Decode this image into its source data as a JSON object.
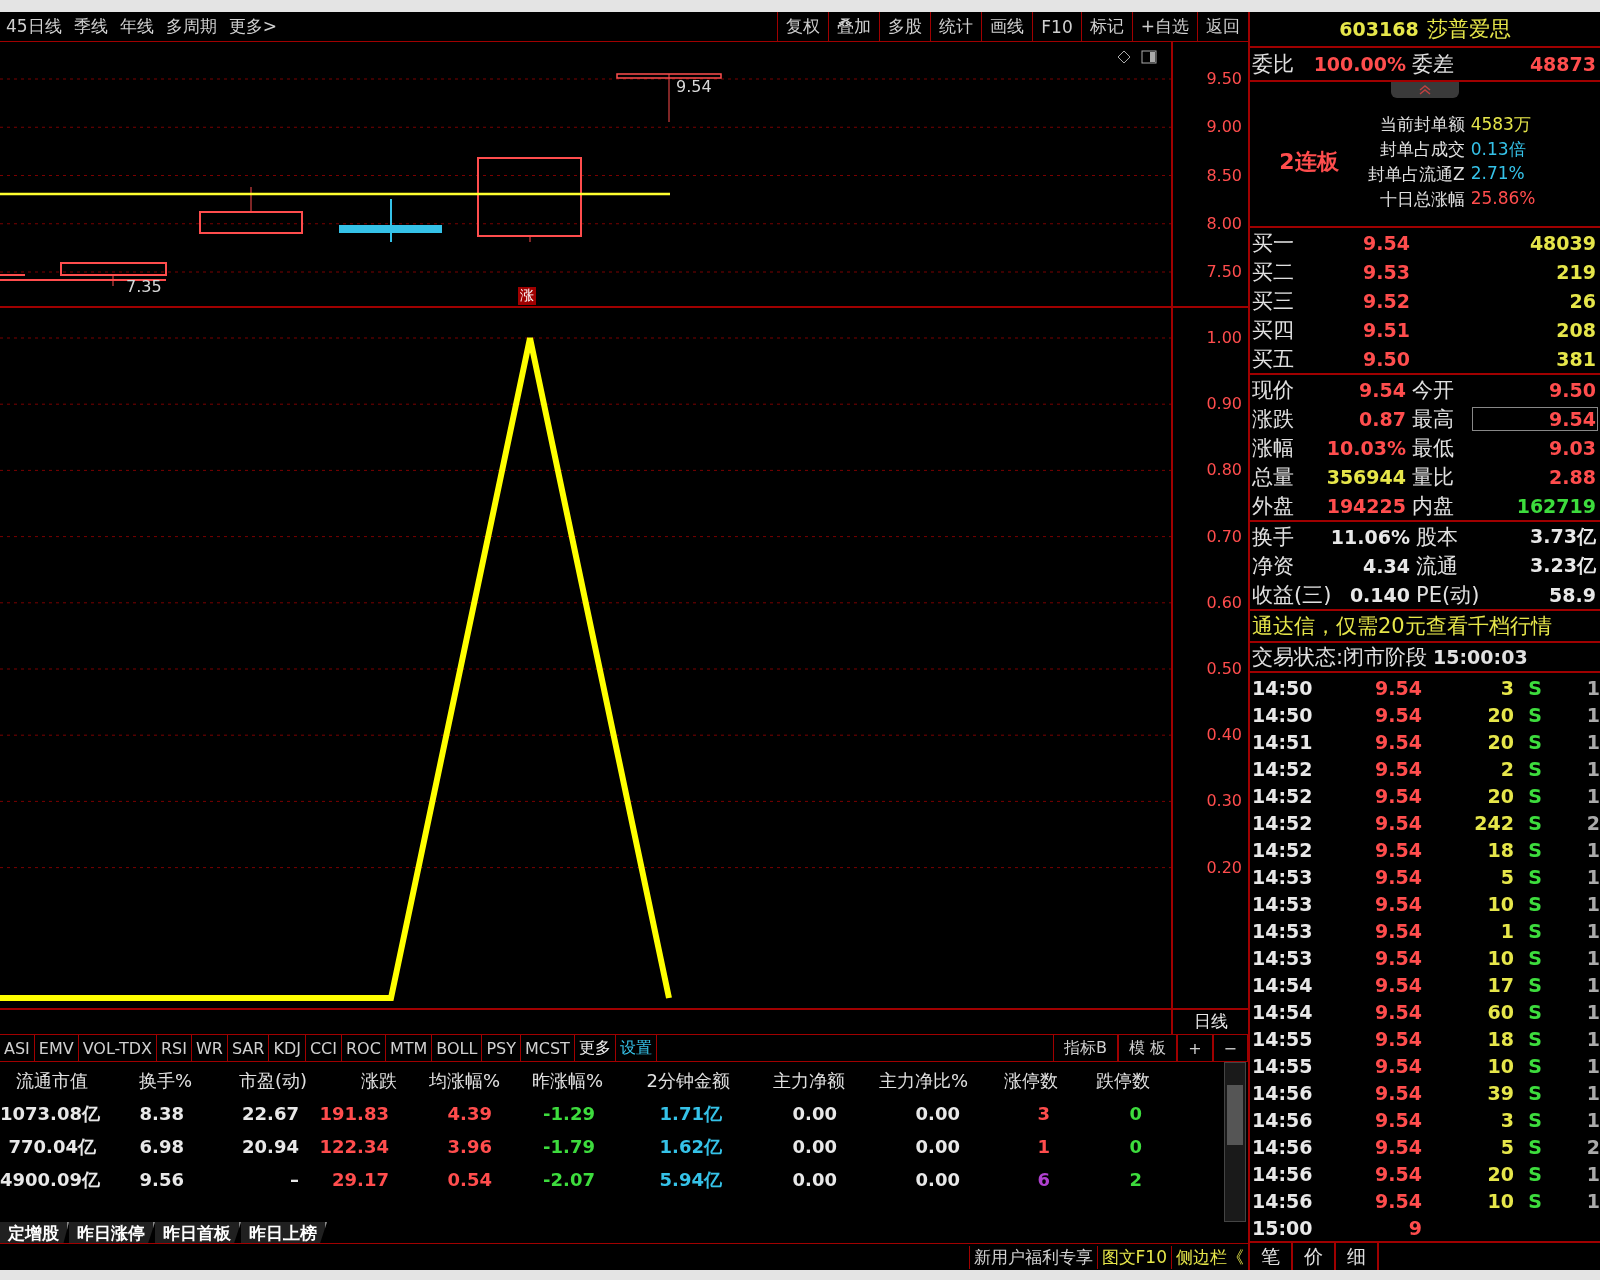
{
  "toolbar": {
    "periods": [
      {
        "label": "45日线",
        "selected": false
      },
      {
        "label": "季线",
        "selected": false
      },
      {
        "label": "年线",
        "selected": false
      },
      {
        "label": "多周期",
        "selected": false
      },
      {
        "label": "更多>",
        "selected": false
      }
    ],
    "actions": [
      "复权",
      "叠加",
      "多股",
      "统计",
      "画线",
      "F10",
      "标记",
      "+自选",
      "返回"
    ]
  },
  "price_chart": {
    "ticks": [
      "9.50",
      "9.00",
      "8.50",
      "8.00",
      "7.50"
    ],
    "high_mark": "9.54",
    "low_mark": "7.35",
    "limit_up_tag": "涨"
  },
  "indicator_chart": {
    "ticks": [
      "1.00",
      "0.90",
      "0.80",
      "0.70",
      "0.60",
      "0.50",
      "0.40",
      "0.30",
      "0.20"
    ],
    "period_label": "日线"
  },
  "indicator_tabs": [
    {
      "label": "ASI",
      "kind": "indicator"
    },
    {
      "label": "EMV",
      "kind": "indicator"
    },
    {
      "label": "VOL-TDX",
      "kind": "indicator"
    },
    {
      "label": "RSI",
      "kind": "indicator"
    },
    {
      "label": "WR",
      "kind": "indicator"
    },
    {
      "label": "SAR",
      "kind": "indicator"
    },
    {
      "label": "KDJ",
      "kind": "indicator"
    },
    {
      "label": "CCI",
      "kind": "indicator"
    },
    {
      "label": "ROC",
      "kind": "indicator"
    },
    {
      "label": "MTM",
      "kind": "indicator"
    },
    {
      "label": "BOLL",
      "kind": "indicator"
    },
    {
      "label": "PSY",
      "kind": "indicator"
    },
    {
      "label": "MCST",
      "kind": "indicator"
    },
    {
      "label": "更多",
      "kind": "more"
    },
    {
      "label": "设置",
      "kind": "settings"
    }
  ],
  "indicator_actions": [
    "指标B",
    "模 板",
    "+",
    "−"
  ],
  "table": {
    "columns": [
      "流通市值",
      "换手%",
      "市盈(动)",
      "涨跌",
      "均涨幅%",
      "昨涨幅%",
      "2分钟金额",
      "主力净额",
      "主力净比%",
      "涨停数",
      "跌停数"
    ],
    "rows": [
      [
        {
          "text": "1073.08亿",
          "color": "#e8e8e8"
        },
        {
          "text": "8.38",
          "color": "#e8e8e8"
        },
        {
          "text": "22.67",
          "color": "#e8e8e8"
        },
        {
          "text": "191.83",
          "color": "#ff4d4d"
        },
        {
          "text": "4.39",
          "color": "#ff4d4d"
        },
        {
          "text": "-1.29",
          "color": "#3ddc3d"
        },
        {
          "text": "1.71亿",
          "color": "#35c2e8"
        },
        {
          "text": "0.00",
          "color": "#e8e8e8"
        },
        {
          "text": "0.00",
          "color": "#e8e8e8"
        },
        {
          "text": "3",
          "color": "#ff4d4d"
        },
        {
          "text": "0",
          "color": "#3ddc3d"
        }
      ],
      [
        {
          "text": "770.04亿",
          "color": "#e8e8e8"
        },
        {
          "text": "6.98",
          "color": "#e8e8e8"
        },
        {
          "text": "20.94",
          "color": "#e8e8e8"
        },
        {
          "text": "122.34",
          "color": "#ff4d4d"
        },
        {
          "text": "3.96",
          "color": "#ff4d4d"
        },
        {
          "text": "-1.79",
          "color": "#3ddc3d"
        },
        {
          "text": "1.62亿",
          "color": "#35c2e8"
        },
        {
          "text": "0.00",
          "color": "#e8e8e8"
        },
        {
          "text": "0.00",
          "color": "#e8e8e8"
        },
        {
          "text": "1",
          "color": "#ff4d4d"
        },
        {
          "text": "0",
          "color": "#3ddc3d"
        }
      ],
      [
        {
          "text": "4900.09亿",
          "color": "#e8e8e8"
        },
        {
          "text": "9.56",
          "color": "#e8e8e8"
        },
        {
          "text": "–",
          "color": "#e8e8e8"
        },
        {
          "text": "29.17",
          "color": "#ff4d4d"
        },
        {
          "text": "0.54",
          "color": "#ff4d4d"
        },
        {
          "text": "-2.07",
          "color": "#3ddc3d"
        },
        {
          "text": "5.94亿",
          "color": "#35c2e8"
        },
        {
          "text": "0.00",
          "color": "#e8e8e8"
        },
        {
          "text": "0.00",
          "color": "#e8e8e8"
        },
        {
          "text": "6",
          "color": "#b040d0"
        },
        {
          "text": "2",
          "color": "#3ddc3d"
        }
      ]
    ]
  },
  "sheet_tabs": [
    "定增股",
    "昨日涨停",
    "昨日首板",
    "昨日上榜"
  ],
  "status_bar": [
    {
      "text": "新用户福利专享",
      "kind": "plain"
    },
    {
      "text": "图文F10",
      "kind": "highlight"
    },
    {
      "text": "侧边栏《",
      "kind": "highlight"
    }
  ],
  "quote": {
    "code": "603168",
    "name": "莎普爱思"
  },
  "order_ratio": [
    {
      "label": "委比",
      "value": "100.00%"
    },
    {
      "label": "委差",
      "value": "48873"
    }
  ],
  "limit_board": {
    "title": "2连板",
    "stats": [
      {
        "label": "当前封单额",
        "value": "4583万",
        "color": "#e6e64a"
      },
      {
        "label": "封单占成交",
        "value": "0.13倍",
        "color": "#35c2e8"
      },
      {
        "label": "封单占流通Z",
        "value": "2.71%",
        "color": "#35c2e8"
      },
      {
        "label": "十日总涨幅",
        "value": "25.86%",
        "color": "#ff4d4d"
      }
    ]
  },
  "bids": [
    {
      "label": "买一",
      "price": "9.54",
      "volume": "48039"
    },
    {
      "label": "买二",
      "price": "9.53",
      "volume": "219"
    },
    {
      "label": "买三",
      "price": "9.52",
      "volume": "26"
    },
    {
      "label": "买四",
      "price": "9.51",
      "volume": "208"
    },
    {
      "label": "买五",
      "price": "9.50",
      "volume": "381"
    }
  ],
  "stats": [
    [
      {
        "label": "现价",
        "value": "9.54",
        "color": "#ff4d4d",
        "highlighted": false
      },
      {
        "label": "今开",
        "value": "9.50",
        "color": "#ff4d4d",
        "highlighted": false
      }
    ],
    [
      {
        "label": "涨跌",
        "value": "0.87",
        "color": "#ff4d4d",
        "highlighted": false
      },
      {
        "label": "最高",
        "value": "9.54",
        "color": "#ff4d4d",
        "highlighted": true
      }
    ],
    [
      {
        "label": "涨幅",
        "value": "10.03%",
        "color": "#ff4d4d",
        "highlighted": false
      },
      {
        "label": "最低",
        "value": "9.03",
        "color": "#ff4d4d",
        "highlighted": false
      }
    ],
    [
      {
        "label": "总量",
        "value": "356944",
        "color": "#e6e64a",
        "highlighted": false
      },
      {
        "label": "量比",
        "value": "2.88",
        "color": "#ff4d4d",
        "highlighted": false
      }
    ],
    [
      {
        "label": "外盘",
        "value": "194225",
        "color": "#ff4d4d",
        "highlighted": false
      },
      {
        "label": "内盘",
        "value": "162719",
        "color": "#3ddc3d",
        "highlighted": false
      }
    ]
  ],
  "fundamentals": [
    [
      {
        "label": "换手",
        "value": "11.06%"
      },
      {
        "label": "股本",
        "value": "3.73亿"
      }
    ],
    [
      {
        "label": "净资",
        "value": "4.34"
      },
      {
        "label": "流通",
        "value": "3.23亿"
      }
    ],
    [
      {
        "label": "收益(三)",
        "value": "0.140"
      },
      {
        "label": "PE(动)",
        "value": "58.9"
      }
    ]
  ],
  "notice": "通达信，仅需20元查看千档行情",
  "trade_status": {
    "label": "交易状态:闭市阶段",
    "time": "15:00:03"
  },
  "ticks": [
    {
      "time": "14:50",
      "price": "9.54",
      "volume": "3",
      "side": "S",
      "count": "1"
    },
    {
      "time": "14:50",
      "price": "9.54",
      "volume": "20",
      "side": "S",
      "count": "1"
    },
    {
      "time": "14:51",
      "price": "9.54",
      "volume": "20",
      "side": "S",
      "count": "1"
    },
    {
      "time": "14:52",
      "price": "9.54",
      "volume": "2",
      "side": "S",
      "count": "1"
    },
    {
      "time": "14:52",
      "price": "9.54",
      "volume": "20",
      "side": "S",
      "count": "1"
    },
    {
      "time": "14:52",
      "price": "9.54",
      "volume": "242",
      "side": "S",
      "count": "2"
    },
    {
      "time": "14:52",
      "price": "9.54",
      "volume": "18",
      "side": "S",
      "count": "1"
    },
    {
      "time": "14:53",
      "price": "9.54",
      "volume": "5",
      "side": "S",
      "count": "1"
    },
    {
      "time": "14:53",
      "price": "9.54",
      "volume": "10",
      "side": "S",
      "count": "1"
    },
    {
      "time": "14:53",
      "price": "9.54",
      "volume": "1",
      "side": "S",
      "count": "1"
    },
    {
      "time": "14:53",
      "price": "9.54",
      "volume": "10",
      "side": "S",
      "count": "1"
    },
    {
      "time": "14:54",
      "price": "9.54",
      "volume": "17",
      "side": "S",
      "count": "1"
    },
    {
      "time": "14:54",
      "price": "9.54",
      "volume": "60",
      "side": "S",
      "count": "1"
    },
    {
      "time": "14:55",
      "price": "9.54",
      "volume": "18",
      "side": "S",
      "count": "1"
    },
    {
      "time": "14:55",
      "price": "9.54",
      "volume": "10",
      "side": "S",
      "count": "1"
    },
    {
      "time": "14:56",
      "price": "9.54",
      "volume": "39",
      "side": "S",
      "count": "1"
    },
    {
      "time": "14:56",
      "price": "9.54",
      "volume": "3",
      "side": "S",
      "count": "1"
    },
    {
      "time": "14:56",
      "price": "9.54",
      "volume": "5",
      "side": "S",
      "count": "2"
    },
    {
      "time": "14:56",
      "price": "9.54",
      "volume": "20",
      "side": "S",
      "count": "1"
    },
    {
      "time": "14:56",
      "price": "9.54",
      "volume": "10",
      "side": "S",
      "count": "1"
    },
    {
      "time": "15:00",
      "price": "9"
    }
  ],
  "panel_tabs": [
    "笔",
    "价",
    "细"
  ]
}
